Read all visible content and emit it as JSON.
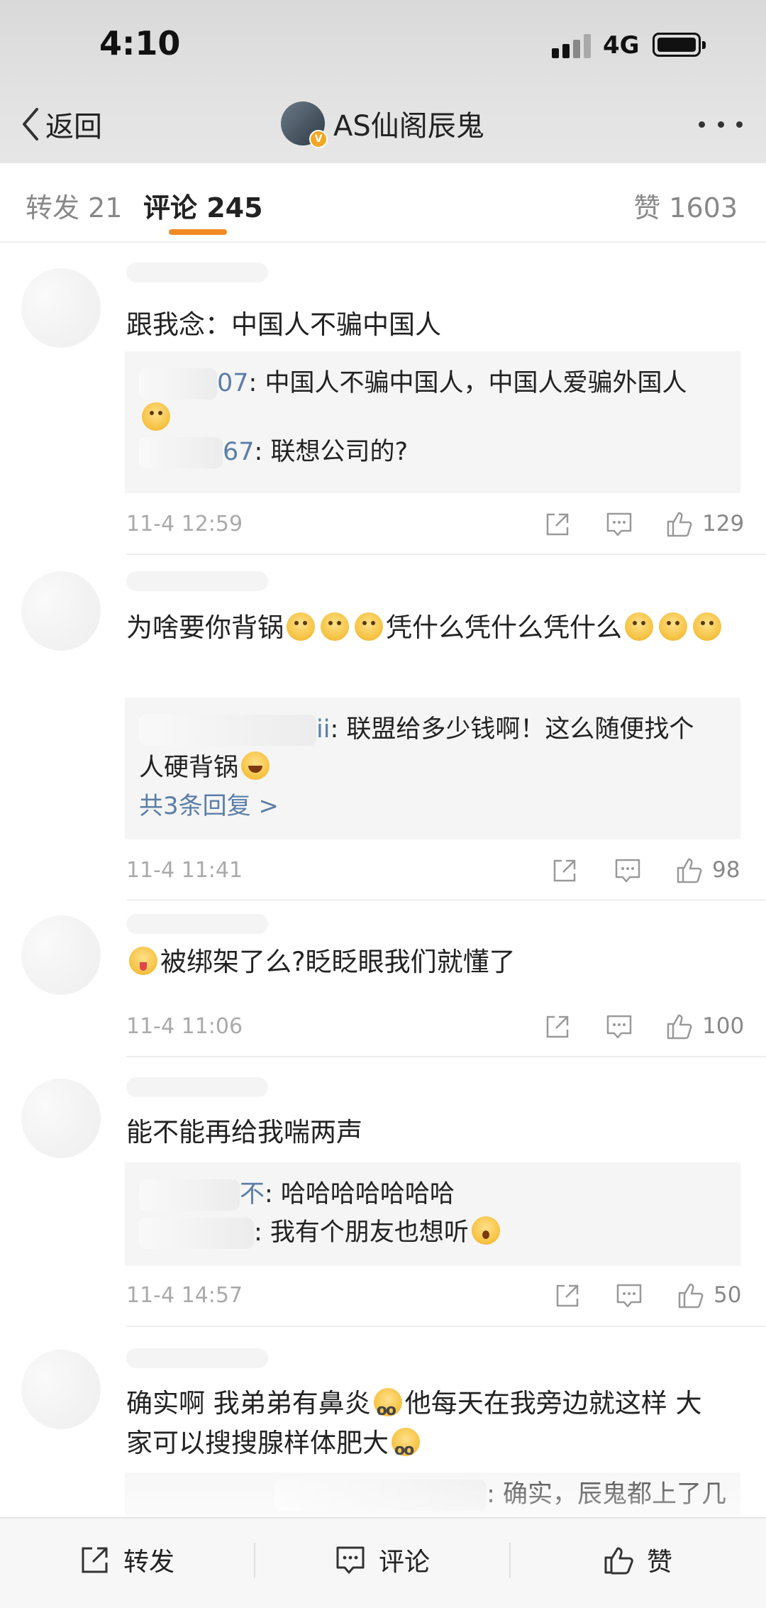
{
  "status_bar": {
    "time": "4:10",
    "network": "4G"
  },
  "nav": {
    "back_label": "返回",
    "title": "AS仙阁辰鬼",
    "verified_badge": "V"
  },
  "tabs": {
    "repost": "转发 21",
    "comments": "评论 245",
    "likes": "赞 1603"
  },
  "comments": [
    {
      "text": "跟我念：中国人不骗中国人",
      "replies": [
        {
          "user_tail": "07",
          "text": ": 中国人不骗中国人，中国人爱骗外国人"
        },
        {
          "user_tail": "67",
          "text": ": 联想公司的?"
        }
      ],
      "time": "11-4 12:59",
      "likes": "129"
    },
    {
      "text_a": "为啥要你背锅",
      "text_b": "凭什么凭什么凭什么",
      "replies": [
        {
          "user_tail": "ii",
          "text": ": 联盟给多少钱啊！这么随便找个",
          "text_cont": "人硬背锅"
        }
      ],
      "more_replies": "共3条回复 >",
      "time": "11-4 11:41",
      "likes": "98"
    },
    {
      "text": "被绑架了么?眨眨眼我们就懂了",
      "time": "11-4 11:06",
      "likes": "100"
    },
    {
      "text": "能不能再给我喘两声",
      "replies": [
        {
          "user_tail": "不",
          "text": ": 哈哈哈哈哈哈哈"
        },
        {
          "user_tail": "",
          "text": ": 我有个朋友也想听"
        }
      ],
      "time": "11-4 14:57",
      "likes": "50"
    },
    {
      "text_a": "确实啊 我弟弟有鼻炎",
      "text_b": "他每天在我旁边就这样 大",
      "text_c": "家可以搜搜腺样体肥大",
      "replies": [
        {
          "user_tail": "",
          "text": ": 确实，辰鬼都上了几"
        }
      ]
    }
  ],
  "bottom_bar": {
    "repost": "转发",
    "comment": "评论",
    "like": "赞"
  },
  "colors": {
    "accent": "#f08a24",
    "link": "#5b7ea8",
    "muted": "#aaaaaa"
  }
}
